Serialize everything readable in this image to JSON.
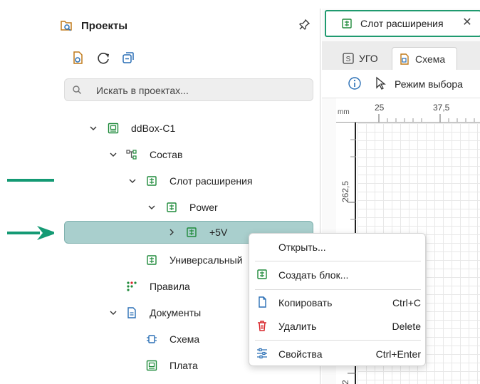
{
  "colors": {
    "accent": "#1f9a6f",
    "selection": "#a9cfcd",
    "arrow": "#149a74",
    "icon_green": "#1e8a3a",
    "delete_red": "#d9262b"
  },
  "panel": {
    "title": "Проекты",
    "icons": [
      "project-tree-icon",
      "pin-icon"
    ],
    "toolbar": [
      "open-project-icon",
      "refresh-icon",
      "collapse-all-icon"
    ],
    "search": {
      "placeholder": "Искать в проектах..."
    },
    "tree": [
      {
        "label": "ddBox-C1",
        "icon": "board-icon",
        "expanded": true
      },
      {
        "label": "Состав",
        "icon": "structure-icon",
        "expanded": true
      },
      {
        "label": "Слот расширения",
        "icon": "block-icon",
        "expanded": true
      },
      {
        "label": "Power",
        "icon": "block-icon",
        "expanded": true
      },
      {
        "label": "+5V",
        "icon": "block-icon",
        "expanded": false,
        "selected": true
      },
      {
        "label": "Универсальный",
        "icon": "block-icon"
      },
      {
        "label": "Правила",
        "icon": "rules-icon"
      },
      {
        "label": "Документы",
        "icon": "documents-icon",
        "expanded": true
      },
      {
        "label": "Схема",
        "icon": "schematic-icon"
      },
      {
        "label": "Плата",
        "icon": "board-icon"
      }
    ]
  },
  "editor": {
    "doc_tab": {
      "label": "Слот расширения",
      "close": "✕"
    },
    "view_tabs": [
      {
        "label": "УГО",
        "icon_text": "S"
      },
      {
        "label": "Схема",
        "active": true
      }
    ],
    "mode_label": "Режим выбора",
    "ruler": {
      "unit": "mm",
      "top_labels": [
        "25",
        "37,5"
      ],
      "left_labels": [
        "262,5",
        "2"
      ]
    }
  },
  "context_menu": {
    "items": [
      {
        "label": "Открыть...",
        "shortcut": ""
      },
      {
        "label": "Создать блок...",
        "shortcut": "",
        "icon": "create-block-icon"
      },
      {
        "label": "Копировать",
        "shortcut": "Ctrl+C",
        "icon": "copy-icon"
      },
      {
        "label": "Удалить",
        "shortcut": "Delete",
        "icon": "trash-icon"
      },
      {
        "label": "Свойства",
        "shortcut": "Ctrl+Enter",
        "icon": "sliders-icon"
      }
    ]
  }
}
